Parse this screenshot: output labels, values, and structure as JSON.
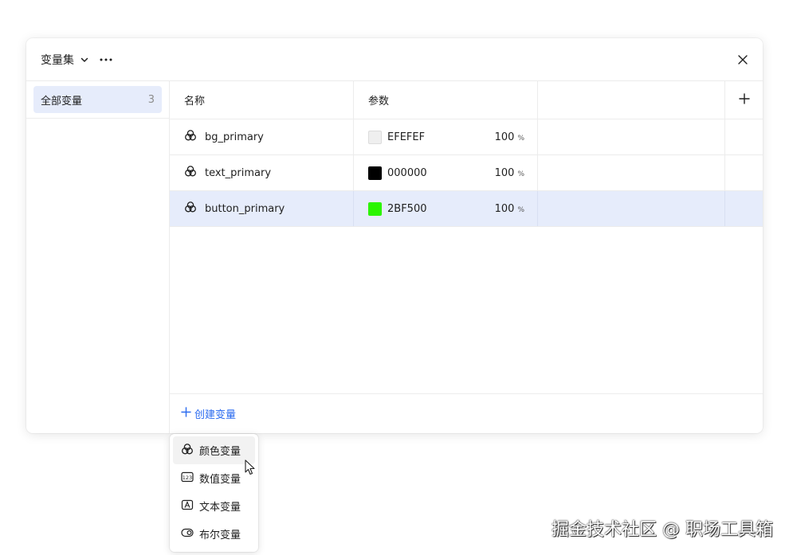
{
  "header": {
    "set_title": "变量集",
    "chevron_icon": "chevron-down-icon",
    "more_icon": "ellipsis-icon",
    "close_icon": "close-icon"
  },
  "sidebar": {
    "items": [
      {
        "label": "全部变量",
        "count": "3"
      }
    ]
  },
  "table": {
    "columns": {
      "name": "名称",
      "param": "参数",
      "add_icon": "plus-icon"
    },
    "rows": [
      {
        "name": "bg_primary",
        "hex": "EFEFEF",
        "color": "#EFEFEF",
        "opacity": "100",
        "unit": "%"
      },
      {
        "name": "text_primary",
        "hex": "000000",
        "color": "#000000",
        "opacity": "100",
        "unit": "%"
      },
      {
        "name": "button_primary",
        "hex": "2BF500",
        "color": "#2BF500",
        "opacity": "100",
        "unit": "%"
      }
    ]
  },
  "footer": {
    "create_label": "创建变量",
    "accent": "#2B6BEF"
  },
  "menu": {
    "items": [
      {
        "label": "颜色变量",
        "icon": "color-variable-icon"
      },
      {
        "label": "数值变量",
        "icon": "number-variable-icon"
      },
      {
        "label": "文本变量",
        "icon": "text-variable-icon"
      },
      {
        "label": "布尔变量",
        "icon": "boolean-variable-icon"
      }
    ]
  },
  "watermark": "掘金技术社区 @ 职场工具箱"
}
